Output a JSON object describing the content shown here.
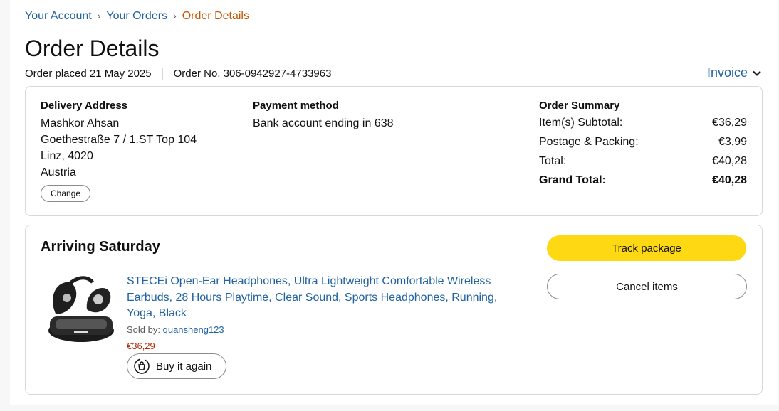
{
  "breadcrumb": {
    "account": "Your Account",
    "orders": "Your Orders",
    "current": "Order Details",
    "separator": "›"
  },
  "page": {
    "title": "Order Details",
    "placed": "Order placed 21 May 2025",
    "order_no": "Order No. 306-0942927-4733963",
    "invoice": "Invoice"
  },
  "delivery": {
    "title": "Delivery Address",
    "name": "Mashkor Ahsan",
    "line1": "Goethestraße 7 / 1.ST Top 104",
    "line2": "Linz, 4020",
    "country": "Austria",
    "change": "Change"
  },
  "payment": {
    "title": "Payment method",
    "value": "Bank account ending in 638"
  },
  "summary": {
    "title": "Order Summary",
    "subtotal_label": "Item(s) Subtotal:",
    "subtotal": "€36,29",
    "postage_label": "Postage & Packing:",
    "postage": "€3,99",
    "total_label": "Total:",
    "total": "€40,28",
    "grand_label": "Grand Total:",
    "grand": "€40,28"
  },
  "shipment": {
    "status": "Arriving Saturday",
    "track": "Track package",
    "cancel": "Cancel items",
    "item_title": "STECEi Open-Ear Headphones, Ultra Lightweight Comfortable Wireless Earbuds, 28 Hours Playtime, Clear Sound, Sports Headphones, Running, Yoga, Black",
    "sold_by_label": "Sold by:",
    "seller": "quansheng123",
    "price": "€36,29",
    "buy_again": "Buy it again"
  },
  "colors": {
    "link": "#2162a1",
    "accent": "#c45500",
    "button_yellow": "#ffd814",
    "price": "#b12704"
  },
  "icons": [
    "chevron-down-icon",
    "buy-again-icon",
    "product-image"
  ]
}
